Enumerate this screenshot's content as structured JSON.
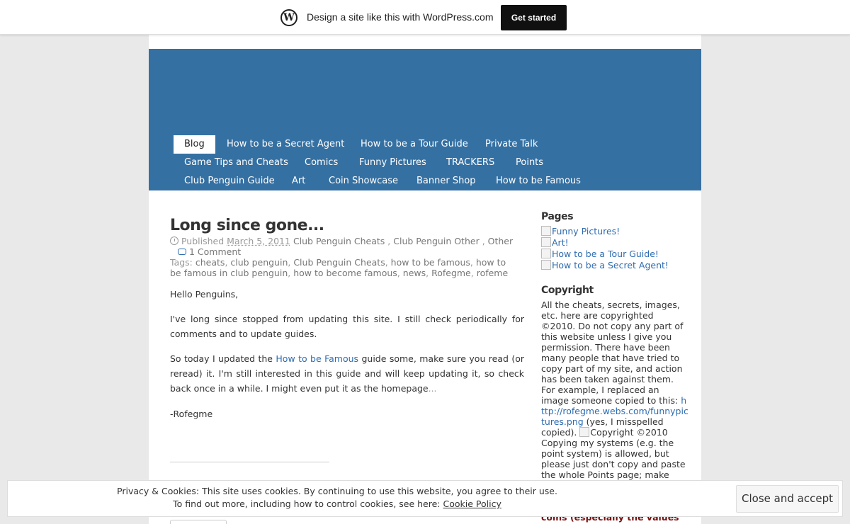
{
  "wp_bar": {
    "logo": "W",
    "text": "Design a site like this with WordPress.com",
    "button": "Get started"
  },
  "nav": {
    "items": [
      "Blog",
      "How to be a Secret Agent",
      "How to be a Tour Guide",
      "Private Talk",
      "Game Tips and Cheats",
      "Comics",
      "Funny Pictures",
      "TRACKERS",
      "Points",
      "Club Penguin Guide",
      "Art",
      "Coin Showcase",
      "Banner Shop",
      "How to be Famous"
    ],
    "active": "Blog"
  },
  "post": {
    "title": "Long since gone...",
    "published_label": "Published",
    "date": "March 5, 2011",
    "categories": [
      "Club Penguin Cheats",
      "Club Penguin Other",
      "Other"
    ],
    "comments": "1 Comment",
    "tags_label": "Tags:",
    "tags": [
      "cheats",
      "club penguin",
      "Club Penguin Cheats",
      "how to be famous",
      "how to be famous in club penguin",
      "how to become famous",
      "news",
      "Rofegme",
      "rofeme"
    ],
    "greeting": "Hello Penguins,",
    "p1": "I've long since stopped from updating this site. I still check periodically for comments and to update guides.",
    "p2_before": "So today I updated the ",
    "p2_link": "How to be Famous",
    "p2_after": " guide some, make sure you read (or reread) it. I'm still interested in this guide and will keep updating it, so check back once in a while. I might even put it as the homepage",
    "p2_ellipsis": "...",
    "signoff": "-Rofegme"
  },
  "sidebar": {
    "pages_title": "Pages",
    "pages": [
      "Funny Pictures!",
      "Art!",
      "How to be a Tour Guide!",
      "How to be a Secret Agent!"
    ],
    "copyright_title": "Copyright",
    "copy1": "All the cheats, secrets, images, etc. here are copyrighted ©2010. Do not copy any part of this website unless I give you permission. There have been many people that have tried to copy part of my site, and action has been taken against them. For example, I replaced an image someone copied to this: ",
    "copy_link": "http://rofegme.webs.com/funnypictures.png",
    "copy2": " (yes, I misspelled copied). ",
    "copy_img_alt": "Copyright ©2010",
    "copy3": " Copying my systems (e.g. the point system) is allowed, but please just don't copy and paste the whole Points page; make",
    "red_text": "coins (especially the values"
  },
  "cookie": {
    "line1": "Privacy & Cookies: This site uses cookies. By continuing to use this website, you agree to their use.",
    "line2_before": "To find out more, including how to control cookies, see here: ",
    "line2_link": "Cookie Policy",
    "button": "Close and accept"
  },
  "colors": {
    "header_blue": "#3570a2",
    "link_blue": "#2e6cb0",
    "red_text": "#7a0f0f"
  }
}
